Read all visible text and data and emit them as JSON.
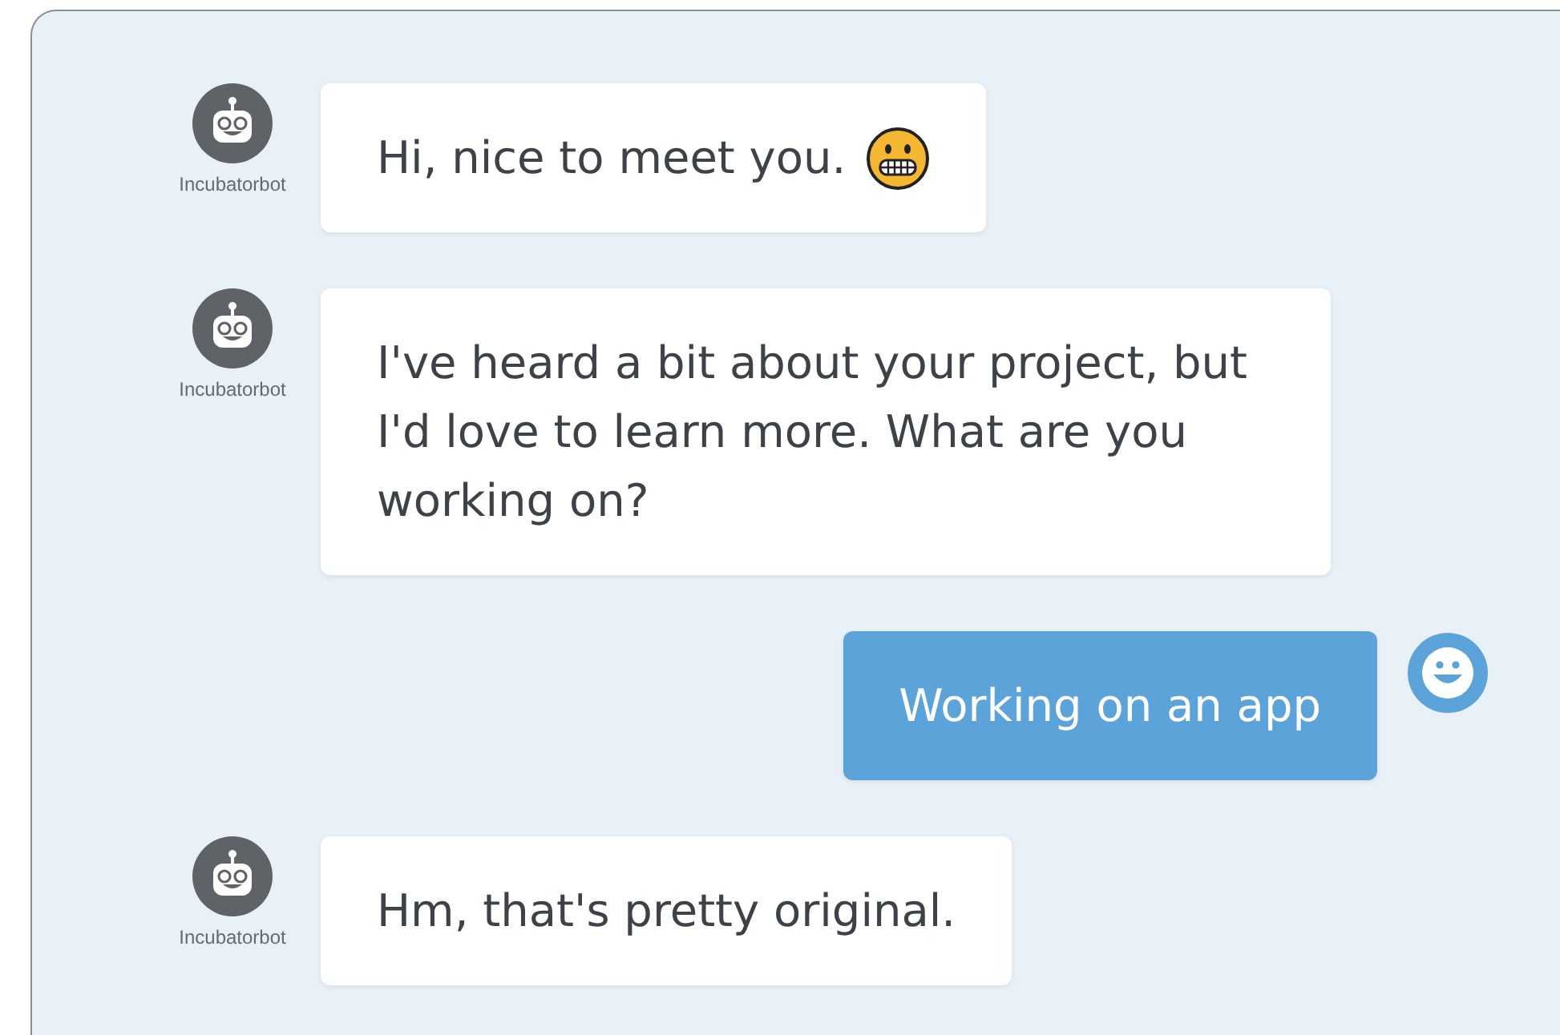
{
  "messages": [
    {
      "kind": "bot",
      "author": "Incubatorbot",
      "text": "Hi, nice to meet you.",
      "trailing_icon": true
    },
    {
      "kind": "bot",
      "author": "Incubatorbot",
      "text": "I've heard a bit about your project, but I'd love to learn more. What are you working on?",
      "trailing_icon": false
    },
    {
      "kind": "user",
      "text": "Working on an app",
      "trailing_icon": false
    },
    {
      "kind": "bot",
      "author": "Incubatorbot",
      "text": "Hm, that's pretty original.",
      "trailing_icon": false
    }
  ]
}
